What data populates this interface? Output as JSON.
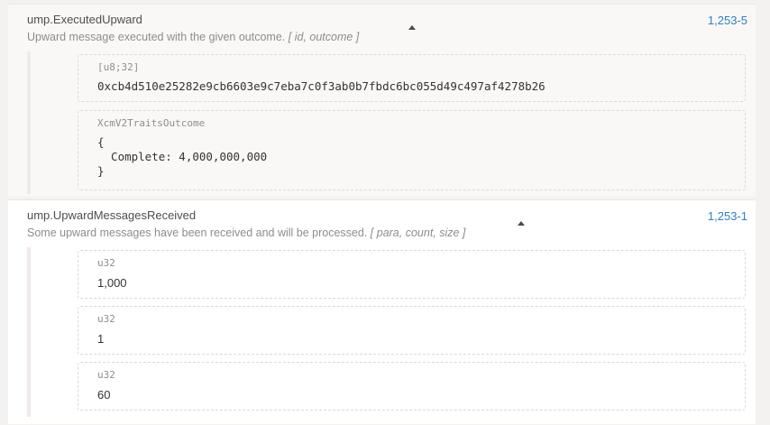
{
  "events": [
    {
      "title": "ump.ExecutedUpward",
      "description": "Upward message executed with the given outcome.",
      "params_hint": "[ id, outcome ]",
      "link": "1,253-5",
      "args": [
        {
          "type": "[u8;32]",
          "value": "0xcb4d510e25282e9cb6603e9c7eba7c0f3ab0b7fbdc6bc055d49c497af4278b26"
        },
        {
          "type": "XcmV2TraitsOutcome",
          "value_lines": [
            "{",
            "  Complete: 4,000,000,000",
            "}"
          ]
        }
      ]
    },
    {
      "title": "ump.UpwardMessagesReceived",
      "description": "Some upward messages have been received and will be processed.",
      "params_hint": "[ para, count, size ]",
      "link": "1,253-1",
      "args": [
        {
          "type": "u32",
          "value": "1,000"
        },
        {
          "type": "u32",
          "value": "1"
        },
        {
          "type": "u32",
          "value": "60"
        }
      ]
    }
  ]
}
